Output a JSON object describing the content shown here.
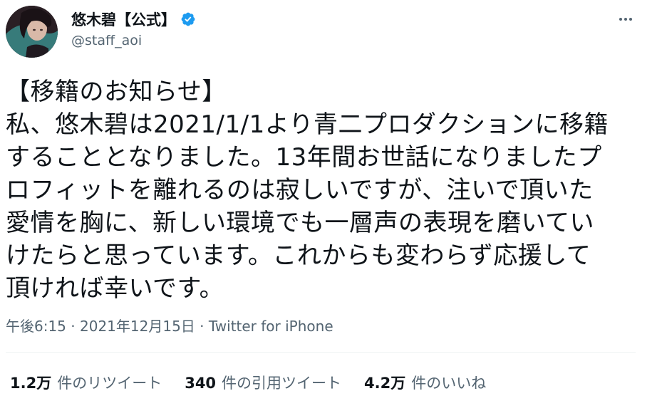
{
  "author": {
    "display_name": "悠木碧【公式】",
    "handle": "@staff_aoi",
    "verified_icon": "verified-badge-icon",
    "avatar_icon": "avatar"
  },
  "menu": {
    "more_icon": "more-horizontal-icon"
  },
  "tweet": {
    "lines": [
      "【移籍のお知らせ】",
      "私、悠木碧は2021/1/1より青二プロダクションに移籍",
      "することとなりました。13年間お世話になりましたプ",
      "ロフィットを離れるのは寂しいですが、注いで頂いた",
      "愛情を胸に、新しい環境でも一層声の表現を磨いてい",
      "けたらと思っています。これからも変わらず応援して",
      "頂ければ幸いです。"
    ]
  },
  "meta": {
    "time": "午後6:15",
    "sep1": "·",
    "date": "2021年12月15日",
    "sep2": "·",
    "source": "Twitter for iPhone"
  },
  "stats": {
    "retweets": {
      "count": "1.2万",
      "label": "件のリツイート"
    },
    "quotes": {
      "count": "340",
      "label": "件の引用ツイート"
    },
    "likes": {
      "count": "4.2万",
      "label": "件のいいね"
    }
  },
  "colors": {
    "verified": "#1d9bf0",
    "text": "#0f1419",
    "secondary": "#536471"
  }
}
